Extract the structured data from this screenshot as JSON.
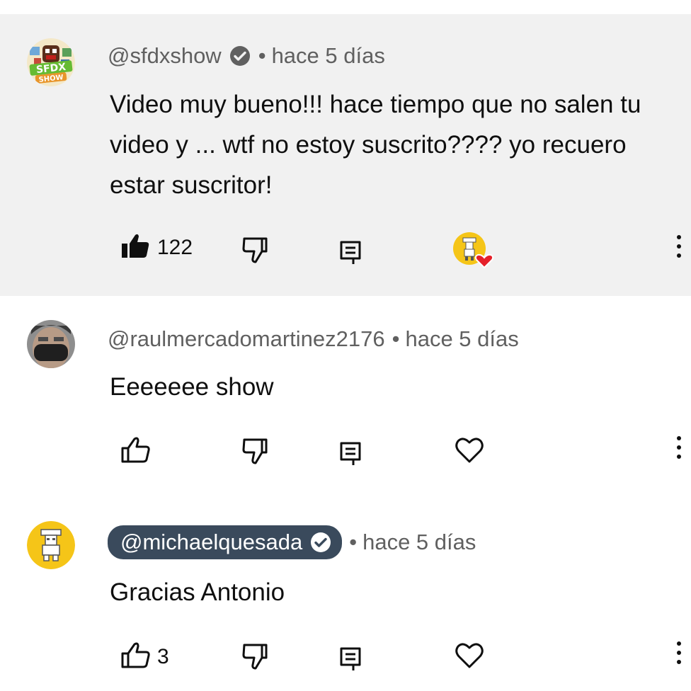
{
  "comments": [
    {
      "handle": "@sfdxshow",
      "verified": true,
      "separator": "•",
      "time": "hace 5 días",
      "text": "Video muy bueno!!! hace tiempo que no salen tu video y ... wtf no estoy suscrito???? yo recuero estar suscritor!",
      "likes": "122",
      "liked": true,
      "creator_heart": true,
      "avatar_logo": "SFDX SHOW"
    },
    {
      "handle": "@raulmercadomartinez2176",
      "verified": false,
      "separator": "•",
      "time": "hace 5 días",
      "text": "Eeeeeee show",
      "likes": "",
      "liked": false,
      "creator_heart": false
    },
    {
      "handle": "@michaelquesada",
      "verified": true,
      "is_creator": true,
      "separator": "•",
      "time": "hace 5 días",
      "text": "Gracias Antonio",
      "likes": "3",
      "liked": false,
      "creator_heart": false
    }
  ],
  "colors": {
    "highlight_bg": "#f1f1f1",
    "creator_pill": "#3a4a5c",
    "heart": "#e5202a",
    "creator_avatar_bg": "#f5c518"
  },
  "icons": [
    "thumbs-up-icon",
    "thumbs-down-icon",
    "reply-icon",
    "heart-icon",
    "more-vert-icon",
    "verified-icon"
  ]
}
